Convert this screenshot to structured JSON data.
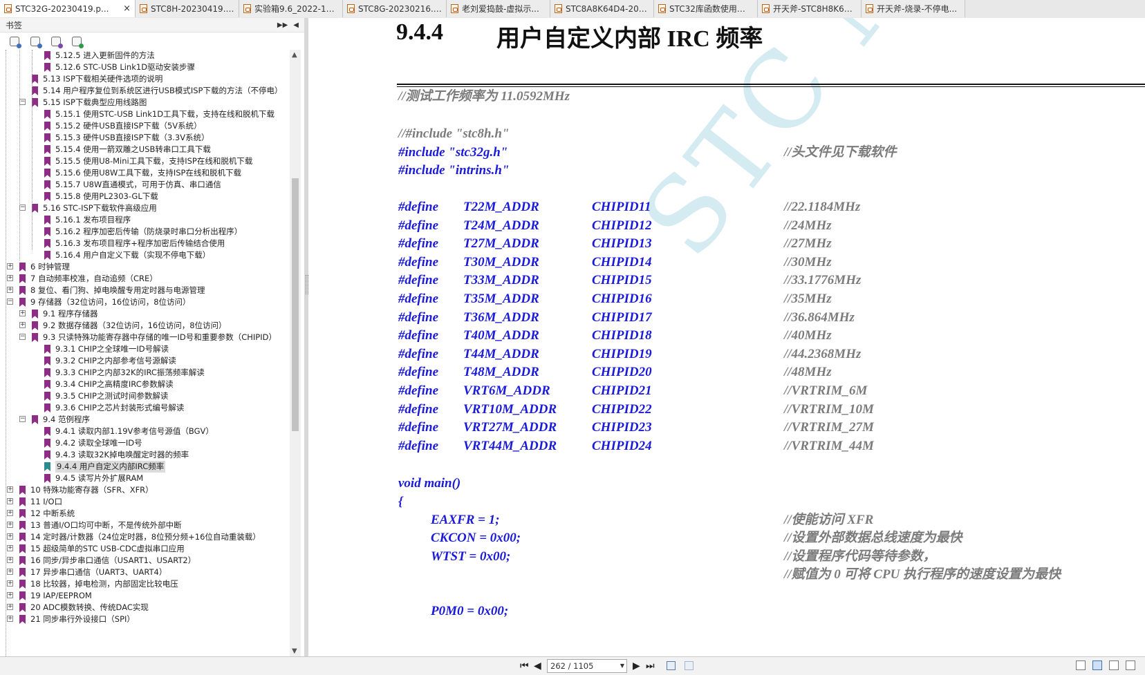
{
  "tabs": [
    {
      "label": "STC32G-20230419.p...",
      "active": true,
      "close": "×"
    },
    {
      "label": "STC8H-20230419.p...",
      "active": false
    },
    {
      "label": "实验箱9.6_2022-12-...",
      "active": false
    },
    {
      "label": "STC8G-20230216.p...",
      "active": false
    },
    {
      "label": "老刘爱捣鼓-虚拟示...",
      "active": false
    },
    {
      "label": "STC8A8K64D4-202...",
      "active": false
    },
    {
      "label": "STC32库函数使用说...",
      "active": false
    },
    {
      "label": "开天斧-STC8H8K64...",
      "active": false
    },
    {
      "label": "开天斧-烧录-不停电...",
      "active": false
    }
  ],
  "sidebar": {
    "title": "书签",
    "controls": [
      "▶▶",
      "◀"
    ],
    "tree": [
      {
        "level": 2,
        "label": "5.12.5 进入更新固件的方法"
      },
      {
        "level": 2,
        "label": "5.12.6 STC-USB Link1D驱动安装步骤"
      },
      {
        "level": 1,
        "label": "5.13 ISP下载相关硬件选项的说明"
      },
      {
        "level": 1,
        "label": "5.14 用户程序复位到系统区进行USB模式ISP下载的方法（不停电）"
      },
      {
        "level": 1,
        "label": "5.15 ISP下载典型应用线路图",
        "exp": "-"
      },
      {
        "level": 2,
        "label": "5.15.1 使用STC-USB Link1D工具下载，支持在线和脱机下载"
      },
      {
        "level": 2,
        "label": "5.15.2 硬件USB直接ISP下载（5V系统）"
      },
      {
        "level": 2,
        "label": "5.15.3 硬件USB直接ISP下载（3.3V系统）"
      },
      {
        "level": 2,
        "label": "5.15.4 使用一箭双雕之USB转串口工具下载"
      },
      {
        "level": 2,
        "label": "5.15.5 使用U8-Mini工具下载，支持ISP在线和脱机下载"
      },
      {
        "level": 2,
        "label": "5.15.6 使用U8W工具下载，支持ISP在线和脱机下载"
      },
      {
        "level": 2,
        "label": "5.15.7 U8W直通模式，可用于仿真、串口通信"
      },
      {
        "level": 2,
        "label": "5.15.8 使用PL2303-GL下载"
      },
      {
        "level": 1,
        "label": "5.16 STC-ISP下载软件高级应用",
        "exp": "-"
      },
      {
        "level": 2,
        "label": "5.16.1 发布项目程序"
      },
      {
        "level": 2,
        "label": "5.16.2 程序加密后传输（防烧录时串口分析出程序）"
      },
      {
        "level": 2,
        "label": "5.16.3 发布项目程序+程序加密后传输结合使用"
      },
      {
        "level": 2,
        "label": "5.16.4 用户自定义下载（实现不停电下载）"
      },
      {
        "level": 0,
        "label": "6 时钟管理",
        "exp": "+"
      },
      {
        "level": 0,
        "label": "7 自动频率校准，自动追频（CRE）",
        "exp": "+"
      },
      {
        "level": 0,
        "label": "8 复位、看门狗、掉电唤醒专用定时器与电源管理",
        "exp": "+"
      },
      {
        "level": 0,
        "label": "9 存储器（32位访问，16位访问，8位访问）",
        "exp": "-"
      },
      {
        "level": 1,
        "label": "9.1 程序存储器",
        "exp": "+"
      },
      {
        "level": 1,
        "label": "9.2 数据存储器（32位访问，16位访问，8位访问）",
        "exp": "+"
      },
      {
        "level": 1,
        "label": "9.3 只读特殊功能寄存器中存储的唯一ID号和重要参数（CHIPID）",
        "exp": "-"
      },
      {
        "level": 2,
        "label": "9.3.1 CHIP之全球唯一ID号解读"
      },
      {
        "level": 2,
        "label": "9.3.2 CHIP之内部参考信号源解读"
      },
      {
        "level": 2,
        "label": "9.3.3 CHIP之内部32K的IRC振荡频率解读"
      },
      {
        "level": 2,
        "label": "9.3.4 CHIP之高精度IRC参数解读"
      },
      {
        "level": 2,
        "label": "9.3.5 CHIP之测试时间参数解读"
      },
      {
        "level": 2,
        "label": "9.3.6 CHIP之芯片封装形式编号解读"
      },
      {
        "level": 1,
        "label": "9.4 范例程序",
        "exp": "-"
      },
      {
        "level": 2,
        "label": "9.4.1 读取内部1.19V参考信号源值（BGV）"
      },
      {
        "level": 2,
        "label": "9.4.2 读取全球唯一ID号"
      },
      {
        "level": 2,
        "label": "9.4.3 读取32K掉电唤醒定时器的频率"
      },
      {
        "level": 2,
        "label": "9.4.4 用户自定义内部IRC频率",
        "selected": true
      },
      {
        "level": 2,
        "label": "9.4.5 读写片外扩展RAM"
      },
      {
        "level": 0,
        "label": "10 特殊功能寄存器（SFR、XFR）",
        "exp": "+"
      },
      {
        "level": 0,
        "label": "11 I/O口",
        "exp": "+"
      },
      {
        "level": 0,
        "label": "12 中断系统",
        "exp": "+"
      },
      {
        "level": 0,
        "label": "13 普通I/O口均可中断，不是传统外部中断",
        "exp": "+"
      },
      {
        "level": 0,
        "label": "14 定时器/计数器（24位定时器，8位预分频+16位自动重装载）",
        "exp": "+"
      },
      {
        "level": 0,
        "label": "15 超级简单的STC USB-CDC虚拟串口应用",
        "exp": "+"
      },
      {
        "level": 0,
        "label": "16 同步/异步串口通信（USART1、USART2）",
        "exp": "+"
      },
      {
        "level": 0,
        "label": "17 异步串口通信（UART3、UART4）",
        "exp": "+"
      },
      {
        "level": 0,
        "label": "18 比较器，掉电检测，内部固定比较电压",
        "exp": "+"
      },
      {
        "level": 0,
        "label": "19 IAP/EEPROM",
        "exp": "+"
      },
      {
        "level": 0,
        "label": "20 ADC模数转换、传统DAC实现",
        "exp": "+"
      },
      {
        "level": 0,
        "label": "21 同步串行外设接口（SPI）",
        "exp": "+"
      }
    ]
  },
  "document": {
    "section_number": "9.4.4",
    "section_title": "用户自定义内部 IRC 频率",
    "watermark": "STC MCU",
    "code_comment_top": "//测试工作频率为 11.0592MHz",
    "include_commented": "//#include \"stc8h.h\"",
    "include_1": "#include \"stc32g.h\"",
    "include_1_comment": "//头文件见下载软件",
    "include_2": "#include \"intrins.h\"",
    "defines": [
      {
        "kw": "#define",
        "name": "T22M_ADDR",
        "value": "CHIPID11",
        "comment": "//22.1184MHz"
      },
      {
        "kw": "#define",
        "name": "T24M_ADDR",
        "value": "CHIPID12",
        "comment": "//24MHz"
      },
      {
        "kw": "#define",
        "name": "T27M_ADDR",
        "value": "CHIPID13",
        "comment": "//27MHz"
      },
      {
        "kw": "#define",
        "name": "T30M_ADDR",
        "value": "CHIPID14",
        "comment": "//30MHz"
      },
      {
        "kw": "#define",
        "name": "T33M_ADDR",
        "value": "CHIPID15",
        "comment": "//33.1776MHz"
      },
      {
        "kw": "#define",
        "name": "T35M_ADDR",
        "value": "CHIPID16",
        "comment": "//35MHz"
      },
      {
        "kw": "#define",
        "name": "T36M_ADDR",
        "value": "CHIPID17",
        "comment": "//36.864MHz"
      },
      {
        "kw": "#define",
        "name": "T40M_ADDR",
        "value": "CHIPID18",
        "comment": "//40MHz"
      },
      {
        "kw": "#define",
        "name": "T44M_ADDR",
        "value": "CHIPID19",
        "comment": "//44.2368MHz"
      },
      {
        "kw": "#define",
        "name": "T48M_ADDR",
        "value": "CHIPID20",
        "comment": "//48MHz"
      },
      {
        "kw": "#define",
        "name": "VRT6M_ADDR",
        "value": "CHIPID21",
        "comment": "//VRTRIM_6M"
      },
      {
        "kw": "#define",
        "name": "VRT10M_ADDR",
        "value": "CHIPID22",
        "comment": "//VRTRIM_10M"
      },
      {
        "kw": "#define",
        "name": "VRT27M_ADDR",
        "value": "CHIPID23",
        "comment": "//VRTRIM_27M"
      },
      {
        "kw": "#define",
        "name": "VRT44M_ADDR",
        "value": "CHIPID24",
        "comment": "//VRTRIM_44M"
      }
    ],
    "main_sig": "void main()",
    "brace": "{",
    "body": [
      {
        "code": "EAXFR = 1;",
        "comment": "//使能访问 XFR"
      },
      {
        "code": "CKCON = 0x00;",
        "comment": "//设置外部数据总线速度为最快"
      },
      {
        "code": "WTST = 0x00;",
        "comment": "//设置程序代码等待参数，"
      },
      {
        "code": "",
        "comment": "//赋值为 0 可将 CPU 执行程序的速度设置为最快"
      },
      {
        "code": "P0M0 = 0x00;",
        "comment": ""
      }
    ]
  },
  "bottombar": {
    "first_page": "⏮",
    "prev_page": "◀",
    "page_field": "262 / 1105",
    "next_page": "▶",
    "last_page": "⏭"
  }
}
